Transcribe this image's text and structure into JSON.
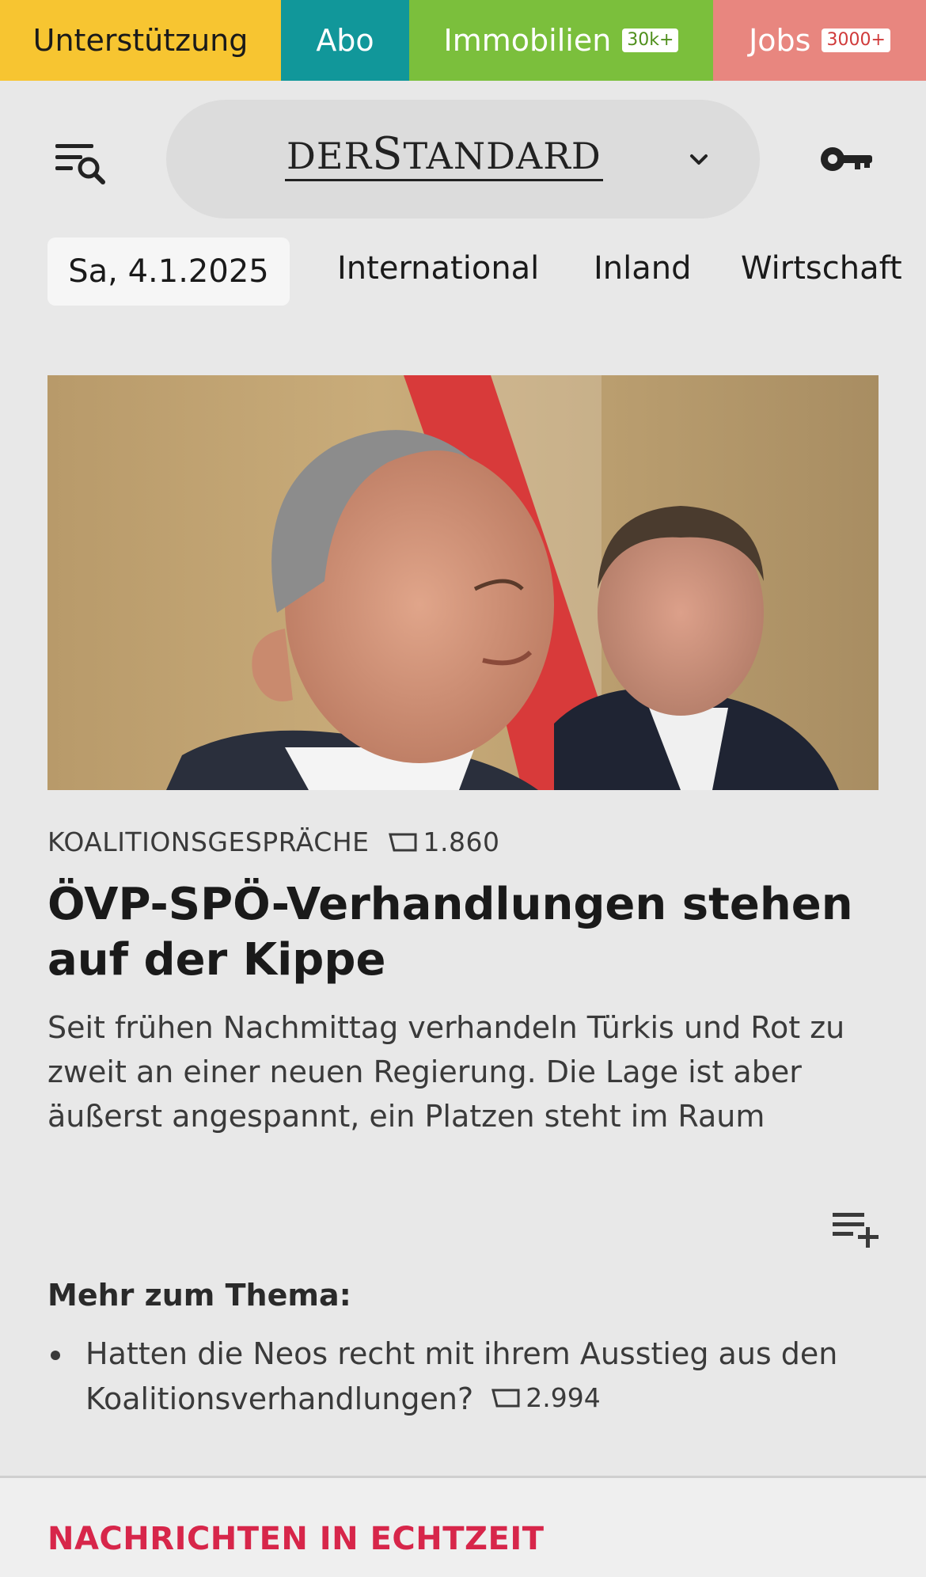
{
  "topbar": {
    "support": "Unterstützung",
    "abo": "Abo",
    "immobilien": {
      "label": "Immobilien",
      "badge": "30k+"
    },
    "jobs": {
      "label": "Jobs",
      "badge": "3000+"
    },
    "colors": {
      "support": "#f7c531",
      "abo": "#11979a",
      "immobilien": "#7bbf3c",
      "jobs": "#e8867f"
    }
  },
  "header": {
    "logo_part1": "DER",
    "logo_s": "S",
    "logo_part2": "TANDARD",
    "icons": [
      "search-menu-icon",
      "chevron-down-icon",
      "key-icon"
    ]
  },
  "nav": {
    "date": "Sa, 4.1.2025",
    "items": [
      "International",
      "Inland",
      "Wirtschaft"
    ]
  },
  "article": {
    "kicker": "KOALITIONSGESPRÄCHE",
    "posts": "1.860",
    "headline": "ÖVP-SPÖ-Verhandlungen stehen auf der Kippe",
    "teaser": "Seit frühen Nachmittag verhandeln Türkis und Rot zu zweit an einer neuen Regierung. Die Lage ist aber äußerst angespannt, ein Platzen steht im Raum"
  },
  "more": {
    "title": "Mehr zum Thema:",
    "items": [
      {
        "text": "Hatten die Neos recht mit ihrem Ausstieg aus den Koalitionsverhandlungen?",
        "posts": "2.994"
      }
    ]
  },
  "live": {
    "title": "NACHRICHTEN IN ECHTZEIT",
    "color": "#d7264a"
  }
}
